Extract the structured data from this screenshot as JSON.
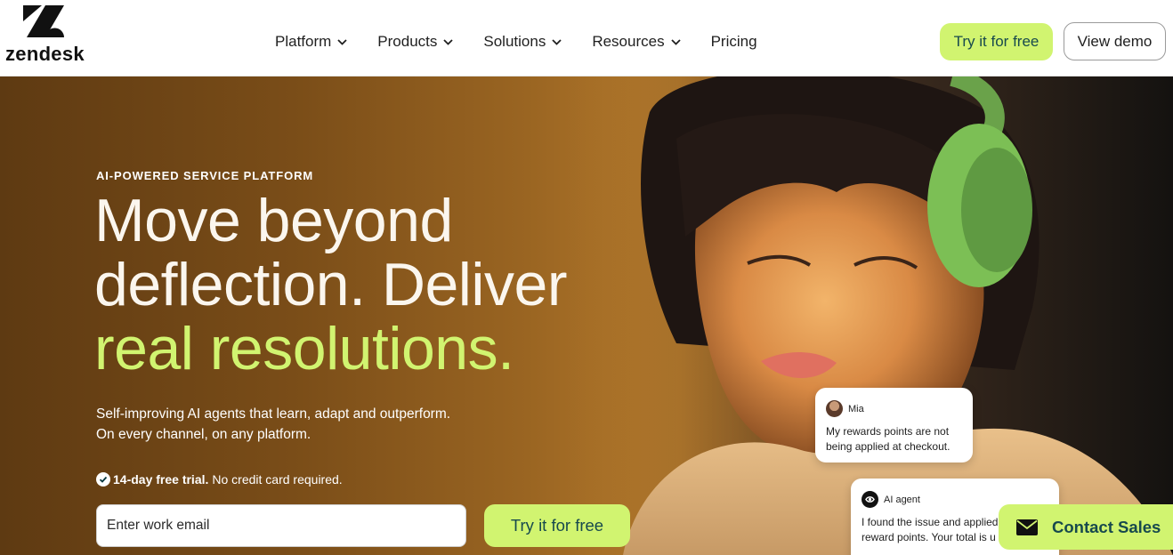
{
  "brand": {
    "name": "zendesk",
    "accent": "#d1f470",
    "text_dark": "#17494d"
  },
  "nav": {
    "items": [
      {
        "label": "Platform",
        "has_menu": true
      },
      {
        "label": "Products",
        "has_menu": true
      },
      {
        "label": "Solutions",
        "has_menu": true
      },
      {
        "label": "Resources",
        "has_menu": true
      },
      {
        "label": "Pricing",
        "has_menu": false
      }
    ],
    "try_label": "Try it for free",
    "demo_label": "View demo"
  },
  "hero": {
    "eyebrow": "AI-POWERED SERVICE PLATFORM",
    "headline_line1": "Move beyond",
    "headline_line2": "deflection. Deliver",
    "headline_accent": "real resolutions.",
    "sub_line1": "Self-improving AI agents that learn, adapt and outperform.",
    "sub_line2": "On every channel, on any platform.",
    "trial_bold": "14-day free trial.",
    "trial_rest": "No credit card required.",
    "email_placeholder": "Enter work email",
    "try_label": "Try it for free"
  },
  "chat": {
    "user_name": "Mia",
    "user_message": "My rewards points are not being applied at checkout.",
    "ai_name": "AI agent",
    "ai_message_line1": "I found the issue and applied",
    "ai_message_line2": "reward points. Your total is u"
  },
  "contact": {
    "label": "Contact Sales"
  },
  "icons": {
    "logo": "zendesk-logo-icon",
    "chevron": "chevron-down-icon",
    "check": "check-circle-icon",
    "ai": "ai-agent-icon",
    "mail": "mail-icon"
  }
}
